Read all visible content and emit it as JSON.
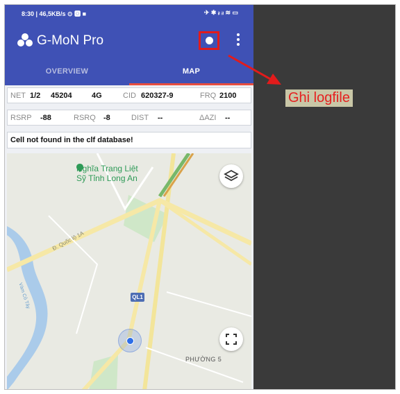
{
  "status_bar": {
    "left": "8:30 | 46,5KB/s ⊙ 🅾 ■",
    "right": "✈ ✱ ᵢₗ ᵢₗ ≋ ▭"
  },
  "app": {
    "title": "G-MoN Pro"
  },
  "tabs": [
    {
      "label": "OVERVIEW",
      "selected": false
    },
    {
      "label": "MAP",
      "selected": true
    }
  ],
  "info": {
    "net_label": "NET",
    "net_value": "1/2",
    "mcc_mnc": "45204",
    "tech": "4G",
    "cid_label": "CID",
    "cid_value": "620327-9",
    "frq_label": "FRQ",
    "frq_value": "2100",
    "rsrp_label": "RSRP",
    "rsrp_value": "-88",
    "rsrq_label": "RSRQ",
    "rsrq_value": "-8",
    "dist_label": "DIST",
    "dist_value": "--",
    "azi_label": "ΔAZI",
    "azi_value": "--",
    "message": "Cell not found in the clf database!"
  },
  "map": {
    "cemetery_line1": "Nghĩa Trang Liệt",
    "cemetery_line2": "Sỹ Tỉnh Long An",
    "road_label": "Đ. Quốc lộ 1A",
    "route_badge": "QL1",
    "ward_label": "PHƯỜNG 5",
    "river_label": "Vàm Cỏ Tây"
  },
  "annotation": {
    "label": "Ghi logfile",
    "color": "#e52020"
  },
  "colors": {
    "app_bar": "#3f51b5",
    "tab_indicator": "#e84e40",
    "record_highlight": "#e21b1b"
  }
}
